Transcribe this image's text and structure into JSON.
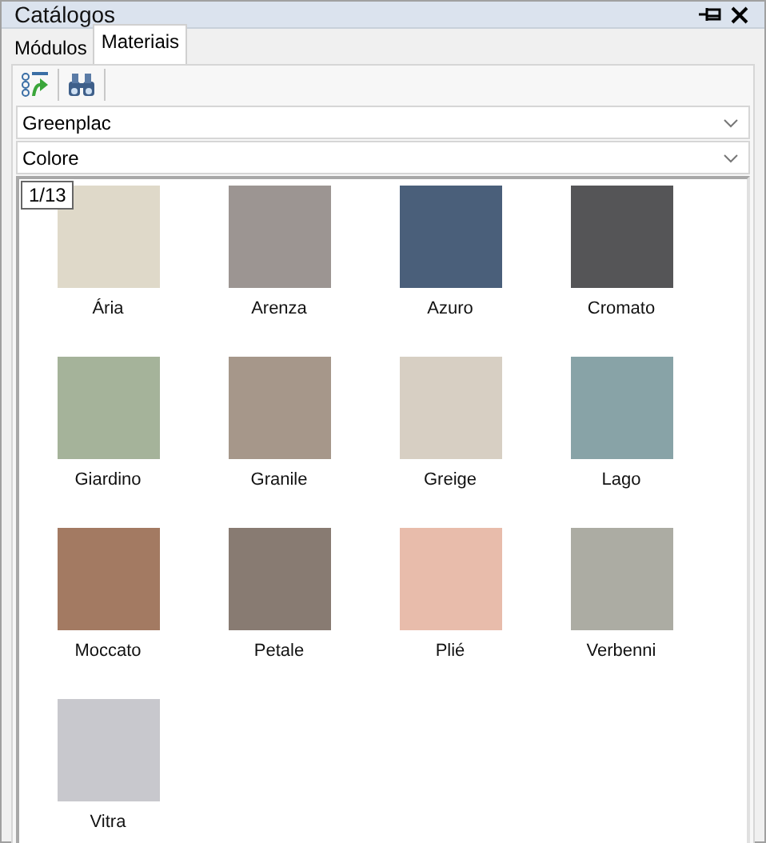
{
  "window": {
    "title": "Catálogos"
  },
  "tabs": [
    {
      "label": "Módulos",
      "selected": false
    },
    {
      "label": "Materiais",
      "selected": true
    }
  ],
  "dropdowns": [
    {
      "value": "Greenplac"
    },
    {
      "value": "Colore"
    }
  ],
  "page_indicator": "1/13",
  "materials": [
    {
      "name": "Ária",
      "color": "#dfd9c9"
    },
    {
      "name": "Arenza",
      "color": "#9c9592"
    },
    {
      "name": "Azuro",
      "color": "#4a5f7a"
    },
    {
      "name": "Cromato",
      "color": "#555557"
    },
    {
      "name": "Giardino",
      "color": "#a5b39a"
    },
    {
      "name": "Granile",
      "color": "#a6978a"
    },
    {
      "name": "Greige",
      "color": "#d7cfc3"
    },
    {
      "name": "Lago",
      "color": "#88a3a7"
    },
    {
      "name": "Moccato",
      "color": "#a37a62"
    },
    {
      "name": "Petale",
      "color": "#887b72"
    },
    {
      "name": "Plié",
      "color": "#e8bcab"
    },
    {
      "name": "Verbenni",
      "color": "#acaca3"
    },
    {
      "name": "Vitra",
      "color": "#c8c8cd"
    }
  ]
}
